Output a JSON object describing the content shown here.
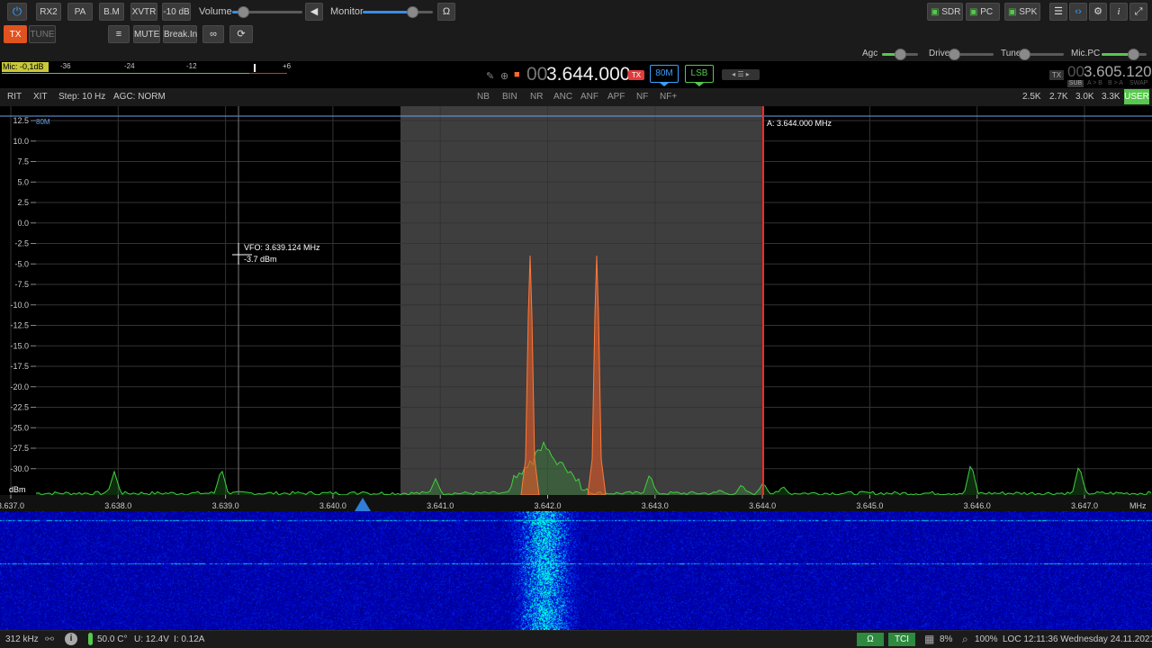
{
  "toolbar": {
    "rx2": "RX2",
    "pa": "PA",
    "bm": "B.M",
    "xvtr": "XVTR",
    "att": "-10 dB",
    "volume_label": "Volume",
    "volume_level": 0.15,
    "monitor_label": "Monitor",
    "monitor_level": 0.7,
    "sdr": "SDR",
    "pc": "PC",
    "spk": "SPK"
  },
  "row2": {
    "tx": "TX",
    "tune": "TUNE",
    "mute": "MUTE",
    "breakin": "Break.In"
  },
  "sliders": {
    "agc": "Agc",
    "agc_level": 0.5,
    "drive": "Drive",
    "drive_level": 0.0,
    "tune": "Tune",
    "tune_level": 0.0,
    "micpc": "Mic.PC",
    "micpc_level": 0.7
  },
  "meter": {
    "label": "Mic: -0,1dB",
    "scale": [
      "-36",
      "-24",
      "-12",
      "+6"
    ]
  },
  "vfoA": {
    "prefix": "00",
    "freq": "3.644.000",
    "tx_badge": "TX",
    "band": "80M",
    "mode": "LSB"
  },
  "vfoB": {
    "tx_label": "TX",
    "prefix": "00",
    "freq": "3.605.120",
    "sub": "SUB",
    "a_to_b": "A > B",
    "b_to_a": "B > A",
    "swap": "SWAP"
  },
  "row3": {
    "rit": "RIT",
    "xit": "XIT",
    "step": "Step: 10 Hz",
    "agc_mode": "AGC: NORM",
    "dsp": [
      "NB",
      "BIN",
      "NR",
      "ANC",
      "ANF",
      "APF",
      "NF",
      "NF+"
    ],
    "filters": [
      "2.5K",
      "2.7K",
      "3.0K",
      "3.3K",
      "USER"
    ]
  },
  "spectrum": {
    "band_label": "80M",
    "y_ticks": [
      "12.5",
      "10.0",
      "7.5",
      "5.0",
      "2.5",
      "0.0",
      "-2.5",
      "-5.0",
      "-7.5",
      "-10.0",
      "-12.5",
      "-15.0",
      "-17.5",
      "-20.0",
      "-22.5",
      "-25.0",
      "-27.5",
      "-30.0"
    ],
    "y_unit": "dBm",
    "x_ticks": [
      "3.637.0",
      "3.638.0",
      "3.639.0",
      "3.640.0",
      "3.641.0",
      "3.642.0",
      "3.643.0",
      "3.644.0",
      "3.645.0",
      "3.646.0",
      "3.647.0"
    ],
    "x_unit": "MHz",
    "marker_a": "A: 3.644.000 MHz",
    "cursor_vfo": "VFO: 3.639.124 MHz",
    "cursor_level": "-3.7 dBm"
  },
  "status": {
    "sample_rate": "312 kHz",
    "temp": "50.0 C°",
    "voltage": "U: 12.4V",
    "current": "I: 0.12A",
    "tci": "TCI",
    "cpu": "8%",
    "zoom": "100%",
    "clock": "LOC 12:11:36 Wednesday 24.11.2021"
  }
}
